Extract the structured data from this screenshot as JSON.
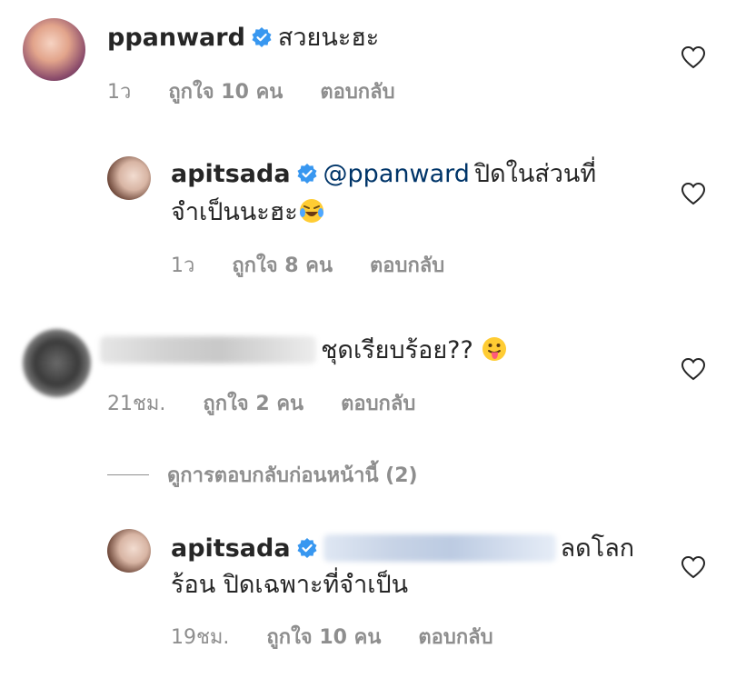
{
  "comments": [
    {
      "username": "ppanward",
      "verified": true,
      "text": "สวยนะฮะ",
      "time": "1ว",
      "likes": "ถูกใจ 10 คน",
      "reply_label": "ตอบกลับ"
    },
    {
      "username": "apitsada",
      "verified": true,
      "mention": "@ppanward",
      "text_line1": "ปิดในส่วนที่",
      "text_line2": "จำเป็นนะฮะ",
      "time": "1ว",
      "likes": "ถูกใจ 8 คน",
      "reply_label": "ตอบกลับ"
    },
    {
      "username": "",
      "verified": false,
      "text": "ชุดเรียบร้อย?? ",
      "time": "21ชม.",
      "likes": "ถูกใจ 2 คน",
      "reply_label": "ตอบกลับ"
    },
    {
      "username": "apitsada",
      "verified": true,
      "text_line1": "ลดโลก",
      "text_line2": "ร้อน ปิดเฉพาะที่จำเป็น",
      "time": "19ชม.",
      "likes": "ถูกใจ 10 คน",
      "reply_label": "ตอบกลับ"
    }
  ],
  "view_replies_label": "ดูการตอบกลับก่อนหน้านี้ (2)",
  "colors": {
    "text": "#262626",
    "meta": "#8e8e8e",
    "verified": "#3897f0",
    "mention": "#003569"
  },
  "icons": [
    "heart-icon",
    "verified-badge-icon",
    "laughing-emoji-icon",
    "tongue-emoji-icon"
  ]
}
